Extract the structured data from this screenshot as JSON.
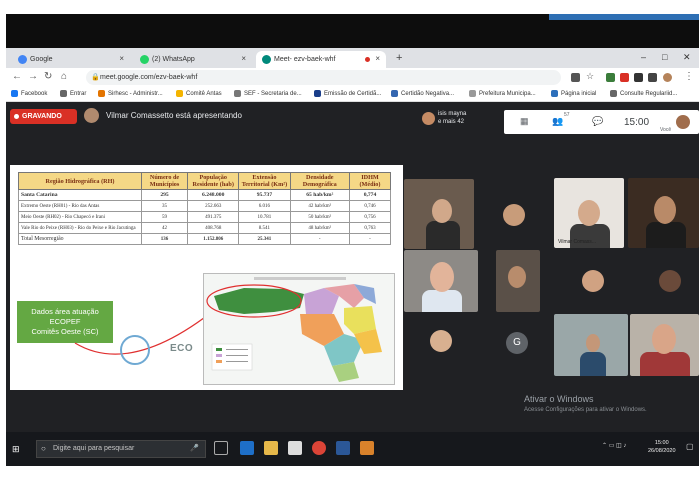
{
  "browser": {
    "tabs": [
      {
        "label": "Google",
        "active": false,
        "favicon_color": "#4285f4"
      },
      {
        "label": "(2) WhatsApp",
        "active": false,
        "favicon_color": "#25d366"
      },
      {
        "label": "Meet- ezv-baek-whf",
        "active": true,
        "favicon_color": "#00897b"
      }
    ],
    "new_tab_symbol": "+",
    "window_controls": [
      "–",
      "□",
      "✕"
    ],
    "url": "meet.google.com/ezv-baek-whf",
    "bookmarks": [
      {
        "label": "Facebook",
        "color": "#1877f2"
      },
      {
        "label": "Entrar",
        "color": "#666666"
      },
      {
        "label": "Sirhesc - Administr...",
        "color": "#e37400"
      },
      {
        "label": "Comitê Antas",
        "color": "#f4b400"
      },
      {
        "label": "SEF - Secretaria de...",
        "color": "#777777"
      },
      {
        "label": "Emissão de Certidã...",
        "color": "#1a3e8a"
      },
      {
        "label": "Certidão Negativa...",
        "color": "#3466b0"
      },
      {
        "label": "Prefeitura Municipa...",
        "color": "#999999"
      },
      {
        "label": "Página inicial",
        "color": "#2c6fbb"
      },
      {
        "label": "Consulte Regulariid...",
        "color": "#666666"
      }
    ]
  },
  "meet": {
    "recording_label": "GRAVANDO",
    "presenting_text": "Vilmar Comassetto está apresentando",
    "others_text_1": "isis mayna",
    "others_text_2": "e mais 42",
    "participant_count": "57",
    "clock": "15:00",
    "you_label": "Você",
    "tile_name": "Vilmar Comass...",
    "g_avatar_letter": "G"
  },
  "slide": {
    "table_headers": [
      "Região Hidrográfica (RH)",
      "Número de Municípios",
      "População Residente (hab)",
      "Extensão Territorial (Km²)",
      "Densidade Demográfica",
      "IDHM (Médio)"
    ],
    "rows": [
      {
        "name": "Santa Catarina",
        "municipios": "295",
        "populacao": "6.248.000",
        "extensao": "95.737",
        "densidade": "65 hab/km²",
        "idhm": "0,774",
        "bold": true
      },
      {
        "name": "Extremo Oeste (RH01) - Rio das Antas",
        "municipios": "35",
        "populacao": "252.663",
        "extensao": "6.016",
        "densidade": "42 hab/km²",
        "idhm": "0,746",
        "bold": false
      },
      {
        "name": "Meio Oeste (RH02) - Rio Chapecó e Irani",
        "municipios": "59",
        "populacao": "491.375",
        "extensao": "10.781",
        "densidade": "50 hab/km²",
        "idhm": "0,756",
        "bold": false
      },
      {
        "name": "Vale Rio do Peixe (RH03) - Rio do Peixe e Rio Jacutinga",
        "municipios": "42",
        "populacao": "408.768",
        "extensao": "8.541",
        "densidade": "48 hab/km²",
        "idhm": "0,763",
        "bold": false
      },
      {
        "name": "Total Mesorregião",
        "municipios": "136",
        "populacao": "1.152.806",
        "extensao": "25.341",
        "densidade": "-",
        "idhm": "-",
        "bold": false
      }
    ],
    "callout_line1": "Dados área atuação",
    "callout_line2": "ECOPEF",
    "callout_line3": "Comitês Oeste (SC)",
    "logo_text": "ECO"
  },
  "windows": {
    "activate_title": "Ativar o Windows",
    "activate_sub": "Acesse Configurações para ativar o Windows.",
    "search_placeholder": "Digite aqui para pesquisar",
    "time": "15:00",
    "date": "26/08/2020"
  }
}
